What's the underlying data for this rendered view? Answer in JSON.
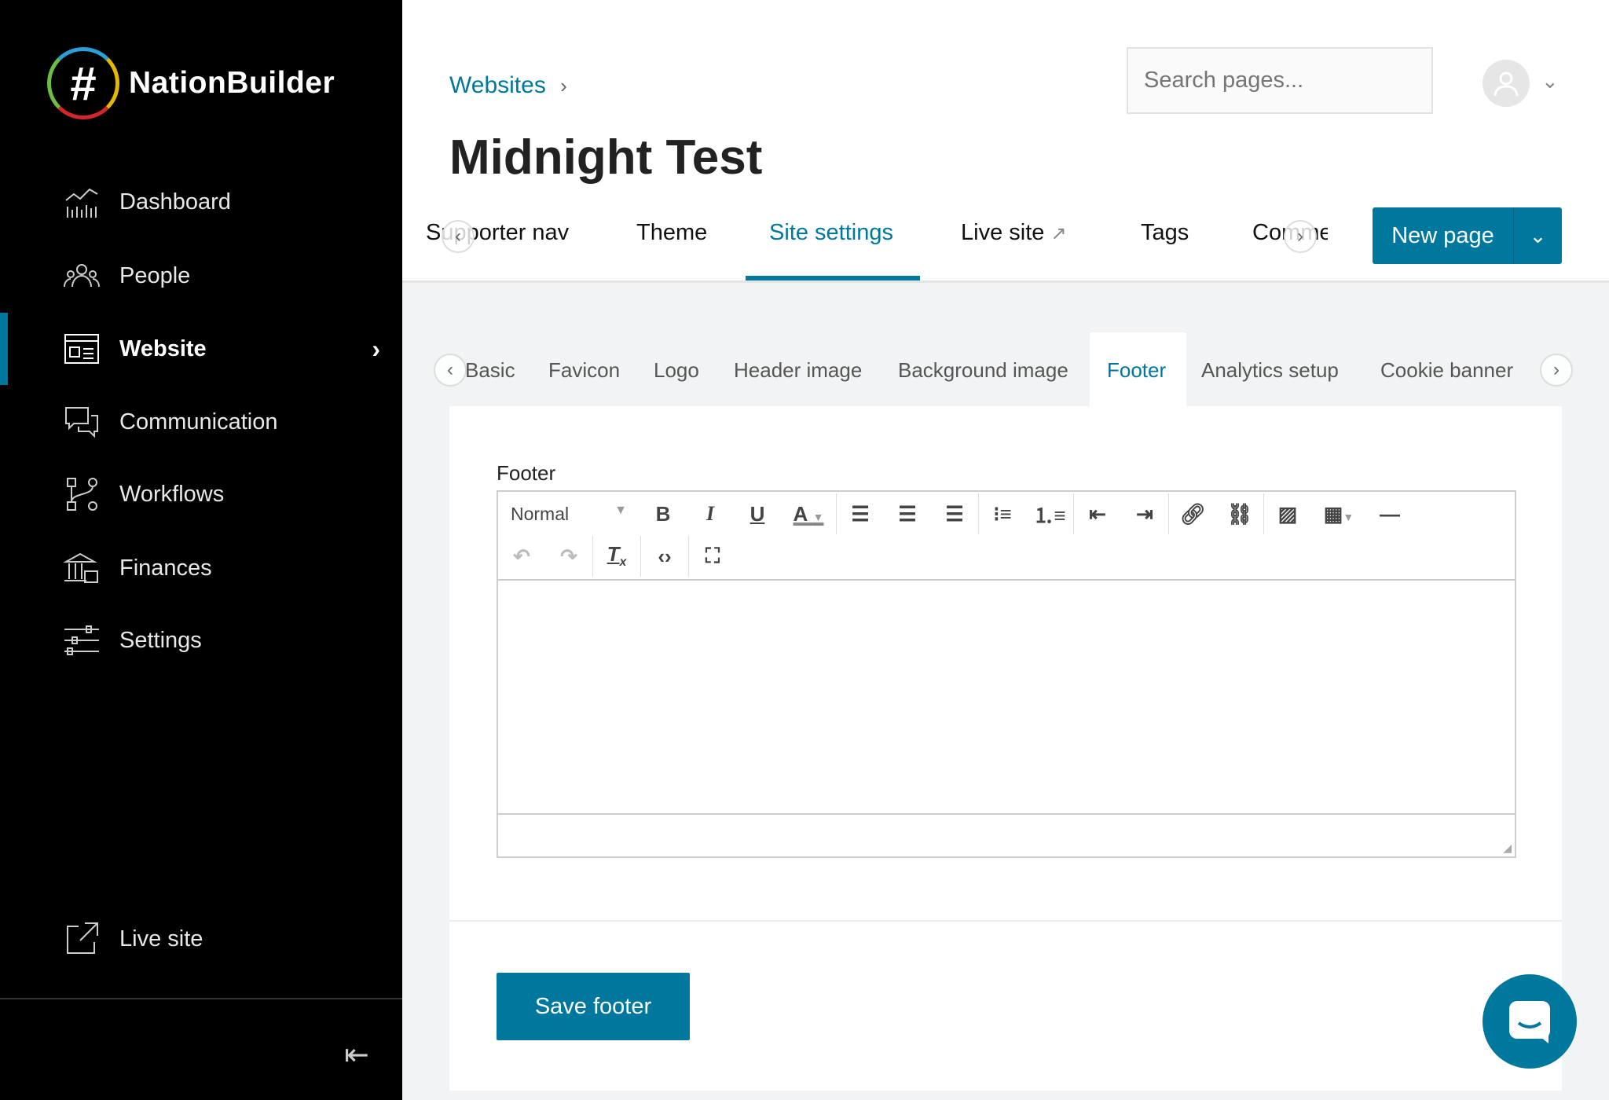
{
  "brand": {
    "name": "NationBuilder",
    "accent": "#00789e"
  },
  "sidebar": {
    "items": [
      {
        "label": "Dashboard",
        "icon": "dashboard-chart-icon"
      },
      {
        "label": "People",
        "icon": "people-icon"
      },
      {
        "label": "Website",
        "icon": "website-icon",
        "active": true
      },
      {
        "label": "Communication",
        "icon": "chat-bubbles-icon"
      },
      {
        "label": "Workflows",
        "icon": "workflow-icon"
      },
      {
        "label": "Finances",
        "icon": "bank-icon"
      },
      {
        "label": "Settings",
        "icon": "sliders-icon"
      }
    ],
    "live_site": "Live site"
  },
  "header": {
    "breadcrumb": "Websites",
    "title": "Midnight Test",
    "search_placeholder": "Search pages...",
    "tabs": [
      "Supporter nav",
      "Theme",
      "Site settings",
      "Live site",
      "Tags",
      "Comme"
    ],
    "active_tab": "Site settings",
    "new_page": "New page"
  },
  "subtabs": {
    "items": [
      "Basic",
      "Favicon",
      "Logo",
      "Header image",
      "Background image",
      "Footer",
      "Analytics setup",
      "Cookie banner"
    ],
    "active": "Footer"
  },
  "editor": {
    "label": "Footer",
    "format": "Normal",
    "content": ""
  },
  "save_label": "Save footer"
}
